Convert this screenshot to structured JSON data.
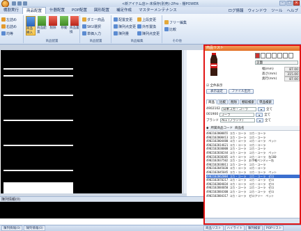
{
  "window": {
    "title": "<新アイテム店>-未保存(別売)-2Pro - 棚POWER"
  },
  "menu": {
    "tabs": [
      "棚割実行",
      "商品配置",
      "什器配置",
      "POP配置",
      "図形配置",
      "補足作成",
      "マスターメンテナンス"
    ],
    "active_index": 1,
    "right": [
      "ログ情報",
      "ウィンドウ",
      "ツール",
      "ヘルプ"
    ]
  },
  "ribbon": {
    "group1": {
      "label": "",
      "buttons": [
        "左詰め",
        "右詰め",
        "均等"
      ]
    },
    "group2": {
      "label": "商品配置",
      "buttons": [
        "商品挿入",
        "商品配置",
        "削除",
        "移動",
        "商品置換"
      ]
    },
    "group3": {
      "label": "商品配置",
      "buttons": [
        "ダミー商品",
        "SKU選択",
        "単価入力"
      ]
    },
    "group4": {
      "label": "商品編集",
      "buttons": [
        "配置変更",
        "陳列点変更",
        "陳列量",
        "上段変更",
        "外形置換",
        "陳列点変更"
      ]
    },
    "group5": {
      "label": "その他",
      "buttons": [
        "フリー編集",
        "比較"
      ]
    }
  },
  "left": {
    "info_label": "陳列情報(0)",
    "tabs": [
      "陳列情報(0)",
      "陳列情報(0)"
    ]
  },
  "right": {
    "title": "商品リスト",
    "dim_select": "正面",
    "dims": [
      {
        "label": "幅(mm)",
        "value": "87.00"
      },
      {
        "label": "高さ(mm)",
        "value": "315.00"
      },
      {
        "label": "奥行(mm)",
        "value": "87.00"
      }
    ],
    "show_all": "全件表示",
    "buttons": {
      "display": "表示設定",
      "file_output": "ファイル出力"
    },
    "tabs": [
      "商品",
      "比較",
      "削除",
      "棚段検索",
      "単品検索"
    ],
    "filters": [
      {
        "code": "4902102",
        "name": "日本コカ・コーラ",
        "extra": "全て"
      },
      {
        "code": "001900",
        "name": "コーラ",
        "extra": "全て"
      },
      {
        "code": "ブランド",
        "name": "ALL (ブランド)",
        "extra": "全て"
      }
    ],
    "list_header": [
      "◆",
      "所属商品コード",
      "商品名"
    ],
    "rows": [
      {
        "code": "4902102000055",
        "name": "コカ・コーラ　コカ・コーラ",
        "sel": false
      },
      {
        "code": "4902102000413",
        "name": "コカ・コーラ　コカ・コーラ",
        "sel": false
      },
      {
        "code": "4902102004480",
        "name": "コカ・コーラ　コカ・コーラ　ペット",
        "sel": false
      },
      {
        "code": "4902102014621",
        "name": "コカ・コーラ　コカ・コーラ",
        "sel": false
      },
      {
        "code": "4902102030000",
        "name": "コカ・コーラ　コカ・コーラ",
        "sel": false
      },
      {
        "code": "4902102030244",
        "name": "コカ・コーラ　コカ・コーラ　ペット",
        "sel": false
      },
      {
        "code": "4902102030305",
        "name": "コカ・コーラ　コカ・コーラ　缶160",
        "sel": false
      },
      {
        "code": "4902102037502",
        "name": "コカ・コーラ　お手軽ベンディー缶",
        "sel": false
      },
      {
        "code": "4902102038011",
        "name": "コカ・コーラ　コカ・コーラ",
        "sel": false
      },
      {
        "code": "4902102045030",
        "name": "コカ・コーラ　コカ・コーラ",
        "sel": false
      },
      {
        "code": "4902102045045",
        "name": "コカ・コーラ　コカ・コーラ　ペット",
        "sel": false
      },
      {
        "code": "4902102062004",
        "name": "コカ・コーラ　コカ・コーラ　ゼロ",
        "sel": true
      },
      {
        "code": "4902102070217",
        "name": "コカ・コーラ　コカ・コーラ　ゼロ",
        "sel": false
      },
      {
        "code": "4902102084034",
        "name": "コカ・コーラ　コカ・コーラ　ゼロ",
        "sel": false
      },
      {
        "code": "4902102084050",
        "name": "コカ・コーラ　コカ・コーラ　ゼロ",
        "sel": false
      },
      {
        "code": "4902102084300",
        "name": "コカ・コーラ　コカ・コーラ　ゼロ",
        "sel": false
      },
      {
        "code": "4902102084317",
        "name": "コカ・コーラ　ゼロフリー　ペット",
        "sel": false
      }
    ]
  },
  "status": {
    "left_tabs": [
      "陳列情報(0)",
      "陳列情報(0)"
    ],
    "right_tabs": [
      "商品リスト",
      "ハイライト",
      "陳列検索",
      "POPリスト"
    ]
  }
}
